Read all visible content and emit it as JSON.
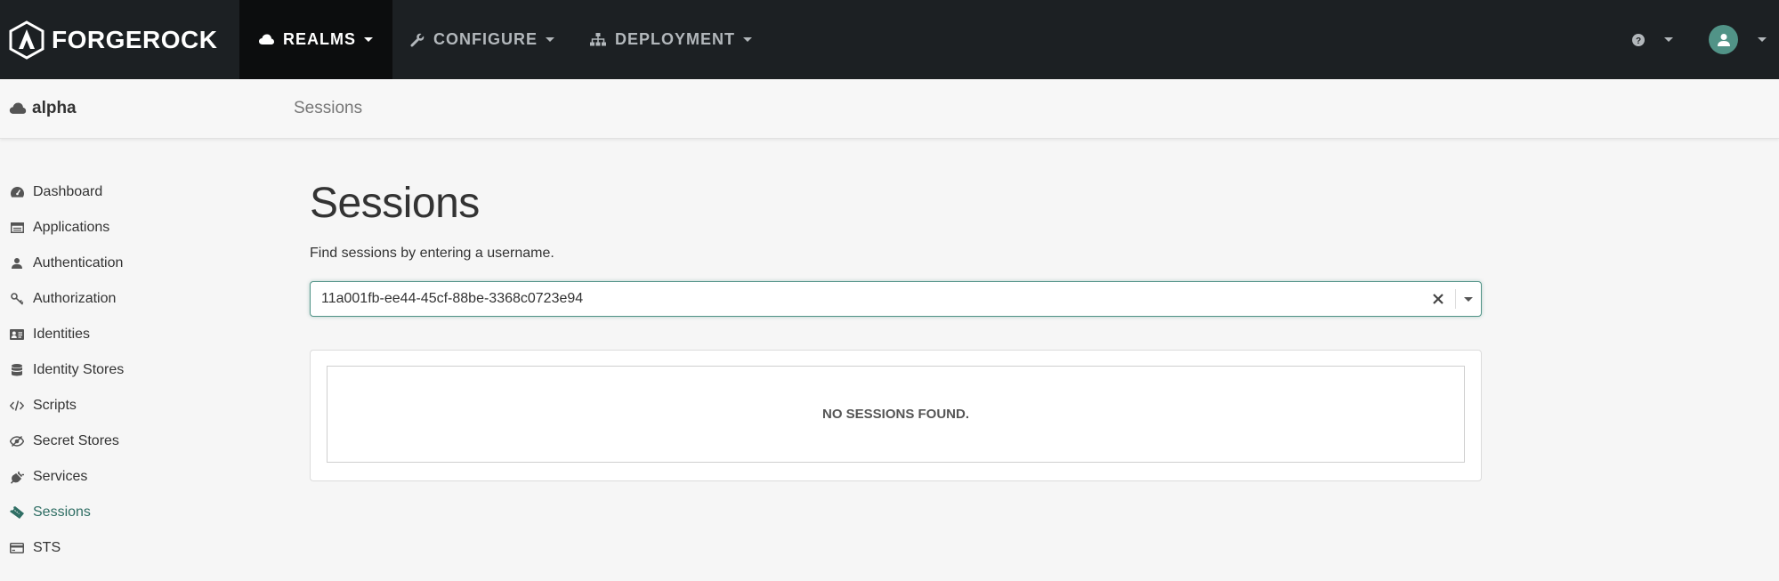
{
  "brand": {
    "name": "FORGEROCK"
  },
  "nav": {
    "items": [
      {
        "label": "REALMS",
        "icon": "cloud-icon"
      },
      {
        "label": "CONFIGURE",
        "icon": "wrench-icon"
      },
      {
        "label": "DEPLOYMENT",
        "icon": "sitemap-icon"
      }
    ],
    "active": "REALMS"
  },
  "realm": {
    "name": "alpha"
  },
  "breadcrumb": {
    "current": "Sessions"
  },
  "sidebar": {
    "items": [
      {
        "label": "Dashboard",
        "icon": "dashboard-icon"
      },
      {
        "label": "Applications",
        "icon": "applications-icon"
      },
      {
        "label": "Authentication",
        "icon": "user-icon"
      },
      {
        "label": "Authorization",
        "icon": "key-icon"
      },
      {
        "label": "Identities",
        "icon": "id-card-icon"
      },
      {
        "label": "Identity Stores",
        "icon": "database-icon"
      },
      {
        "label": "Scripts",
        "icon": "code-icon"
      },
      {
        "label": "Secret Stores",
        "icon": "eye-slash-icon"
      },
      {
        "label": "Services",
        "icon": "plug-icon"
      },
      {
        "label": "Sessions",
        "icon": "ticket-icon"
      },
      {
        "label": "STS",
        "icon": "credit-card-icon"
      }
    ],
    "active": "Sessions"
  },
  "main": {
    "title": "Sessions",
    "help_text": "Find sessions by entering a username.",
    "search": {
      "value": "11a001fb-ee44-45cf-88be-3368c0723e94"
    },
    "empty_message": "NO SESSIONS FOUND."
  },
  "colors": {
    "navbar": "#1c2023",
    "accent": "#519387",
    "active_sidebar": "#2f6e64"
  }
}
